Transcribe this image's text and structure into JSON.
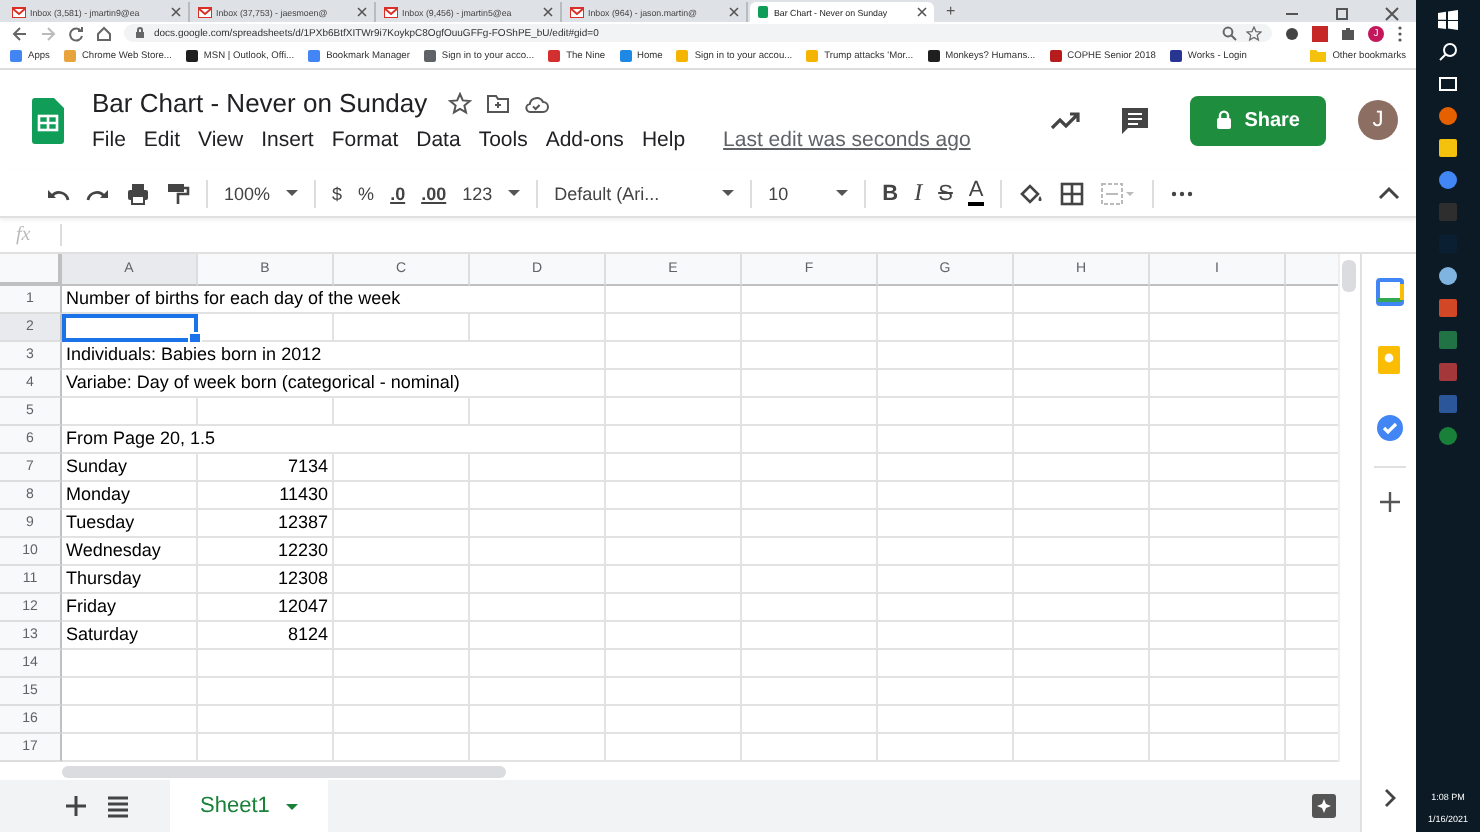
{
  "browser": {
    "tabs": [
      {
        "label": "Inbox (3,581) - jmartin9@ea",
        "selected": false
      },
      {
        "label": "Inbox (37,753) - jaesmoen@",
        "selected": false
      },
      {
        "label": "Inbox (9,456) - jmartin5@ea",
        "selected": false
      },
      {
        "label": "Inbox (964) - jason.martin@",
        "selected": false
      },
      {
        "label": "Bar Chart - Never on Sunday",
        "selected": true
      }
    ],
    "new_tab": "+",
    "url": "docs.google.com/spreadsheets/d/1PXb6BtfXITWr9i7KoykpC8OgfOuuGFFg-FOShPE_bU/edit#gid=0",
    "profile_initial": "J",
    "bookmarks": [
      {
        "label": "Apps",
        "color": "#4285f4"
      },
      {
        "label": "Chrome Web Store...",
        "color": "#e8a33d"
      },
      {
        "label": "MSN | Outlook, Offi...",
        "color": "#1f1f1f"
      },
      {
        "label": "Bookmark Manager",
        "color": "#4285f4"
      },
      {
        "label": "Sign in to your acco...",
        "color": "#5f6368"
      },
      {
        "label": "The Nine",
        "color": "#d32f2f"
      },
      {
        "label": "Home",
        "color": "#1e88e5"
      },
      {
        "label": "Sign in to your accou...",
        "color": "#f4b400"
      },
      {
        "label": "Trump attacks 'Mor...",
        "color": "#f4b400"
      },
      {
        "label": "Monkeys? Humans...",
        "color": "#1f1f1f"
      },
      {
        "label": "COPHE Senior 2018",
        "color": "#b71c1c"
      },
      {
        "label": "Works - Login",
        "color": "#283593"
      }
    ],
    "other_bookmarks": "Other bookmarks"
  },
  "doc": {
    "title": "Bar Chart - Never on Sunday",
    "menu": [
      "File",
      "Edit",
      "View",
      "Insert",
      "Format",
      "Data",
      "Tools",
      "Add-ons",
      "Help"
    ],
    "last_edit": "Last edit was seconds ago",
    "share": "Share",
    "avatar": "J"
  },
  "toolbar": {
    "zoom": "100%",
    "currency": "$",
    "percent": "%",
    "decrease_decimal": ".0",
    "increase_decimal": ".00",
    "number_format": "123",
    "font": "Default (Ari...",
    "font_size": "10",
    "bold": "B",
    "italic": "I",
    "strikethrough": "S",
    "text_color": "A"
  },
  "formula_bar": {
    "label": "fx"
  },
  "sheet": {
    "columns": [
      "A",
      "B",
      "C",
      "D",
      "E",
      "F",
      "G",
      "H",
      "I"
    ],
    "rows": [
      {
        "number": "1",
        "a": "Number of births for each day of the week",
        "b": "",
        "selected": false
      },
      {
        "number": "2",
        "a": "",
        "b": "",
        "selected": true
      },
      {
        "number": "3",
        "a": "Individuals: Babies born in 2012",
        "b": "",
        "selected": false
      },
      {
        "number": "4",
        "a": "Variabe: Day of week born (categorical - nominal)",
        "b": "",
        "selected": false
      },
      {
        "number": "5",
        "a": "",
        "b": "",
        "selected": false
      },
      {
        "number": "6",
        "a": "From Page 20, 1.5",
        "b": "",
        "selected": false
      },
      {
        "number": "7",
        "a": "Sunday",
        "b": "7134",
        "selected": false
      },
      {
        "number": "8",
        "a": "Monday",
        "b": "11430",
        "selected": false
      },
      {
        "number": "9",
        "a": "Tuesday",
        "b": "12387",
        "selected": false
      },
      {
        "number": "10",
        "a": "Wednesday",
        "b": "12230",
        "selected": false
      },
      {
        "number": "11",
        "a": "Thursday",
        "b": "12308",
        "selected": false
      },
      {
        "number": "12",
        "a": "Friday",
        "b": "12047",
        "selected": false
      },
      {
        "number": "13",
        "a": "Saturday",
        "b": "8124",
        "selected": false
      },
      {
        "number": "14",
        "a": "",
        "b": "",
        "selected": false
      },
      {
        "number": "15",
        "a": "",
        "b": "",
        "selected": false
      },
      {
        "number": "16",
        "a": "",
        "b": "",
        "selected": false
      },
      {
        "number": "17",
        "a": "",
        "b": "",
        "selected": false
      }
    ]
  },
  "sheet_tabs": [
    {
      "label": "Sheet1",
      "selected": true
    }
  ],
  "taskbar": {
    "time": "1:08 PM",
    "date": "1/16/2021"
  }
}
